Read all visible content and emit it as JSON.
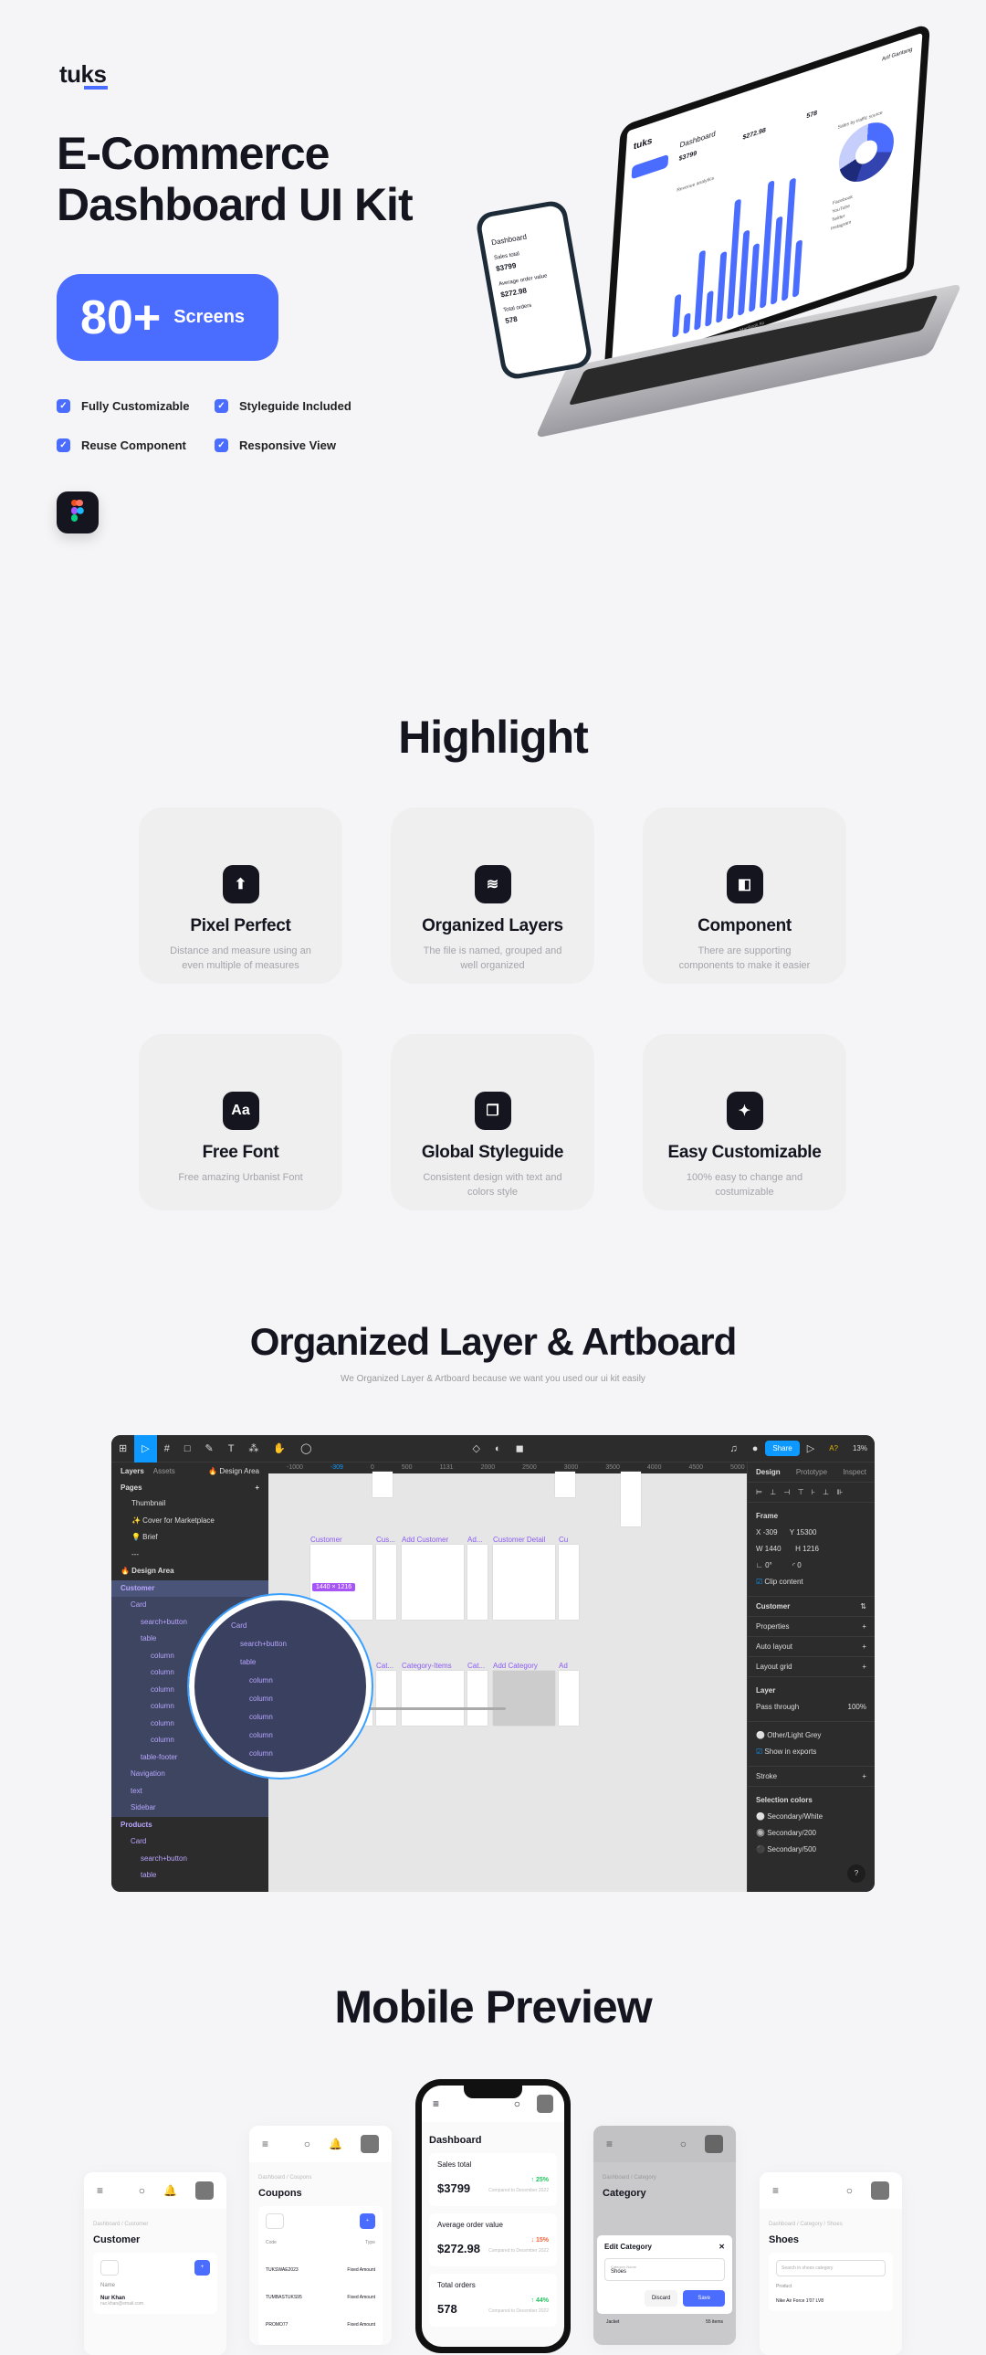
{
  "brand": {
    "logo": "tuks",
    "accent": "#4a6cff",
    "dark": "#14151f"
  },
  "hero": {
    "title_line1": "E-Commerce",
    "title_line2": "Dashboard UI Kit",
    "badge_number": "80+",
    "badge_label": "Screens",
    "features": [
      "Fully Customizable",
      "Styleguide Included",
      "Reuse Component",
      "Responsive View"
    ],
    "tool_icon": "figma-icon"
  },
  "mockup": {
    "laptop_label": "MacBook Air",
    "dashboard_title": "Dashboard",
    "sales_total_label": "Sales total",
    "sales_total": "$3799",
    "sales_change": "↑ 25%",
    "aov_label": "Average order value",
    "aov": "$272.98",
    "aov_change": "↓ 15%",
    "orders_label": "Total orders",
    "orders": "578",
    "orders_change": "↑ 44%",
    "chart_title": "Revenue analytics",
    "traffic_title": "Sales by traffic source",
    "sources": [
      "Facebook",
      "YouTube",
      "Twitter",
      "Instagram"
    ],
    "user": "Arif Gantang",
    "bars": [
      30,
      14,
      56,
      25,
      50,
      85,
      60,
      48,
      90,
      62,
      87,
      40
    ]
  },
  "highlight": {
    "title": "Highlight",
    "cards": [
      {
        "icon": "pointer-icon",
        "title": "Pixel Perfect",
        "desc": "Distance and measure using an even multiple of measures"
      },
      {
        "icon": "layers-icon",
        "title": "Organized Layers",
        "desc": "The file is named, grouped and well organized"
      },
      {
        "icon": "component-icon",
        "title": "Component",
        "desc": "There are supporting components to make it easier"
      },
      {
        "icon": "font-icon",
        "title": "Free Font",
        "desc": "Free amazing Urbanist Font",
        "glyph": "Aa"
      },
      {
        "icon": "styleguide-icon",
        "title": "Global Styleguide",
        "desc": "Consistent design with text and colors style"
      },
      {
        "icon": "magic-wand-icon",
        "title": "Easy Customizable",
        "desc": "100% easy to change and costumizable"
      }
    ]
  },
  "artboard": {
    "title": "Organized Layer & Artboard",
    "subtitle": "We Organized Layer & Artboard because we want you used our ui kit easily",
    "figma": {
      "tabs": [
        "Layers",
        "Assets"
      ],
      "page_selector": "🔥 Design Area",
      "pages_label": "Pages",
      "pages": [
        "Thumbnail",
        "✨ Cover for Marketplace",
        "💡 Brief",
        "---",
        "🔥 Design Area"
      ],
      "layers": [
        "Customer",
        "Card",
        "search+button",
        "table",
        "column",
        "column",
        "column",
        "column",
        "column",
        "column",
        "table-footer",
        "Navigation",
        "text",
        "Sidebar",
        "Products",
        "Card",
        "search+button",
        "table"
      ],
      "ruler": [
        "-1000",
        "-309",
        "0",
        "500",
        "1131",
        "2000",
        "2500",
        "3000",
        "3500",
        "4000",
        "4500",
        "5000",
        "550"
      ],
      "frames_row1": [
        "Customer",
        "Cus...",
        "Add Customer",
        "Ad...",
        "Customer Detail",
        "Cu"
      ],
      "frames_row2": [
        "Category",
        "Cat...",
        "Category-Items",
        "Cat...",
        "Add Category",
        "Ad"
      ],
      "size_badge": "1440 × 1216",
      "share": "Share",
      "zoom": "13%",
      "alert": "A?",
      "right_tabs": [
        "Design",
        "Prototype",
        "Inspect"
      ],
      "frame_label": "Frame",
      "x": "-309",
      "y": "15300",
      "w": "1440",
      "h": "1216",
      "rotation": "0°",
      "radius": "0",
      "clip": "Clip content",
      "component": "Customer",
      "sections": [
        "Properties",
        "Auto layout",
        "Layout grid"
      ],
      "layer_label": "Layer",
      "blend": "Pass through",
      "opacity": "100%",
      "fill": "Other/Light Grey",
      "show_exports": "Show in exports",
      "stroke": "Stroke",
      "selection_colors": "Selection colors",
      "colors": [
        "Secondary/White",
        "Secondary/200",
        "Secondary/500"
      ],
      "help": "?"
    }
  },
  "mobile": {
    "title": "Mobile Preview",
    "customer": {
      "breadcrumb": "Dashboard / Customer",
      "title": "Customer",
      "col": "Name",
      "name": "Nur Khan",
      "email": "nur.khan@email.com"
    },
    "coupons": {
      "breadcrumb": "Dashboard / Coupons",
      "title": "Coupons",
      "cols": [
        "Code",
        "Type"
      ],
      "rows": [
        [
          "TUKSWAE2023",
          "Fixed Amount"
        ],
        [
          "TUMBASTUKS95",
          "Fixed Amount"
        ],
        [
          "PROMO77",
          "Fixed Amount"
        ]
      ]
    },
    "dashboard": {
      "title": "Dashboard",
      "compare": "Compared to December 2022"
    },
    "category": {
      "breadcrumb": "Dashboard / Category",
      "title": "Category",
      "modal_title": "Edit Category",
      "field_label": "Category Name",
      "field_value": "Shoes",
      "discard": "Discard",
      "save": "Save",
      "row": "Jacket",
      "row_count": "55 items"
    },
    "shoes": {
      "breadcrumb": "Dashboard / Category / Shoes",
      "title": "Shoes",
      "search_placeholder": "Search in shoes category",
      "col": "Product",
      "item": "Nike Air Force 1'07 LV8"
    }
  }
}
